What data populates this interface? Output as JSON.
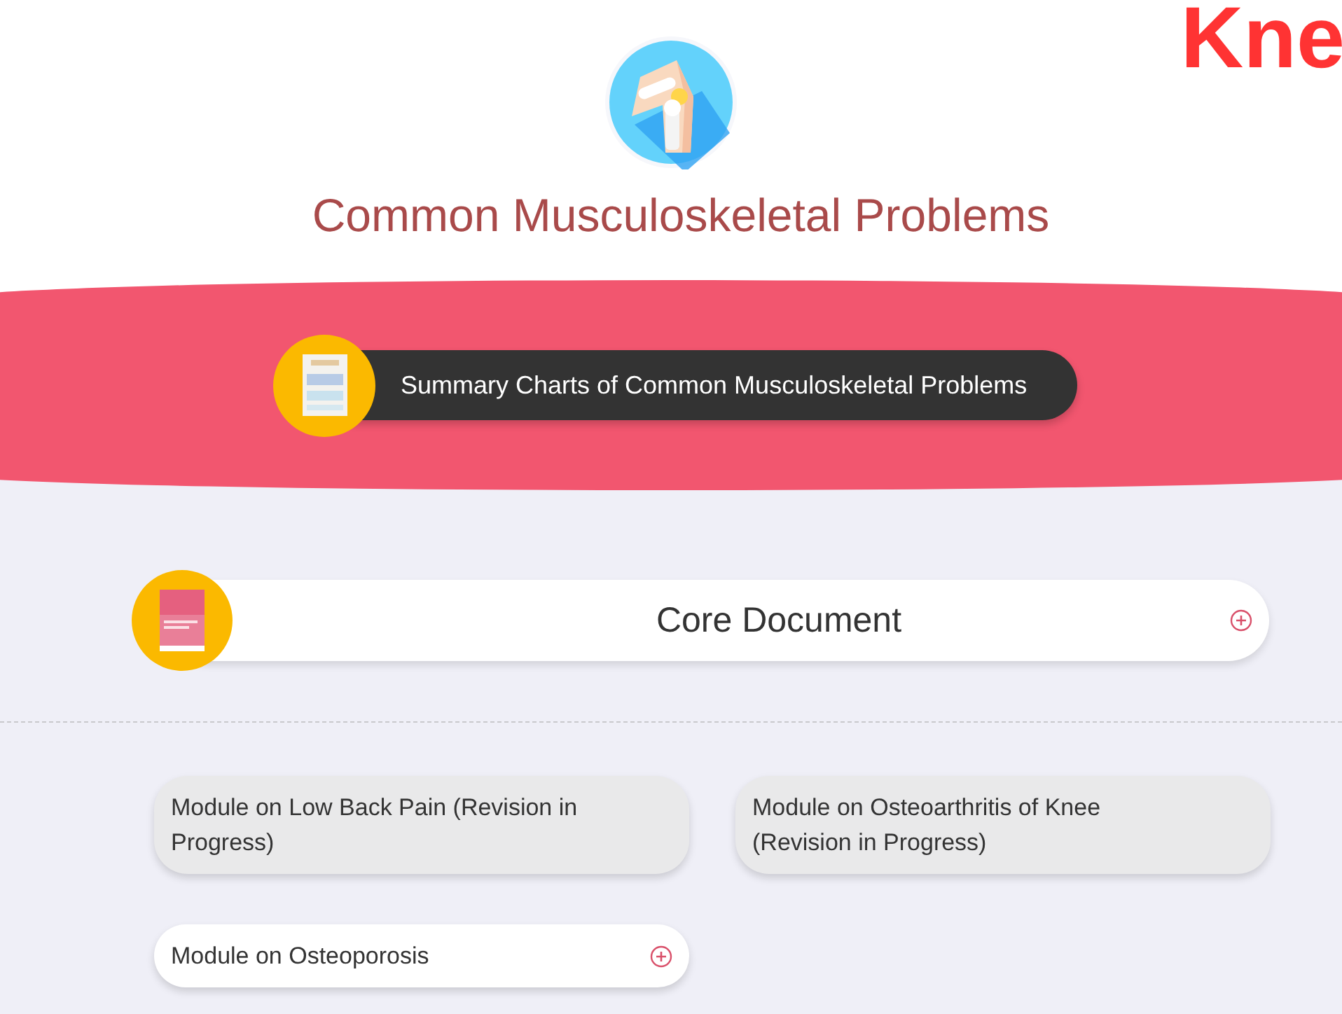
{
  "header": {
    "title": "Common Musculoskeletal Problems",
    "corner_text": "Kne"
  },
  "summary_link": {
    "label": "Summary Charts of Common Musculoskeletal Problems"
  },
  "core_document": {
    "label": "Core Document",
    "expandable": true
  },
  "modules": [
    {
      "label": "Module on Low Back Pain (Revision in Progress)",
      "disabled": true
    },
    {
      "label": "Module on Osteoarthritis of Knee (Revision in Progress)",
      "disabled": true
    },
    {
      "label": "Module on Osteoporosis",
      "disabled": false
    }
  ]
}
